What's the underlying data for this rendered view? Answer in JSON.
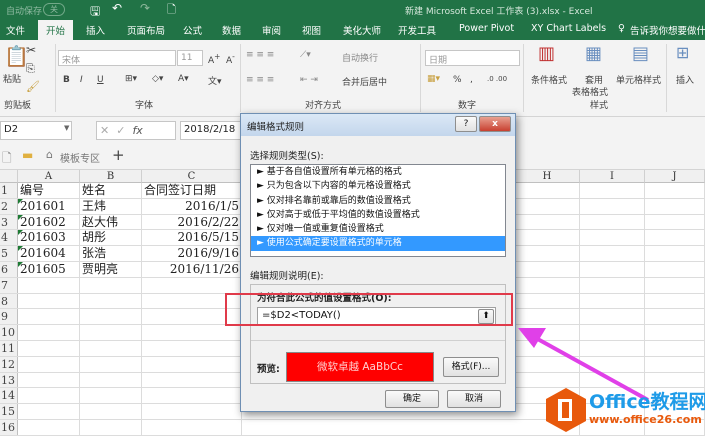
{
  "titlebar": {
    "autosave": "自动保存",
    "autosave_state": "关",
    "title": "新建 Microsoft Excel 工作表 (3).xlsx  -  Excel"
  },
  "tabs": [
    "文件",
    "开始",
    "插入",
    "页面布局",
    "公式",
    "数据",
    "审阅",
    "视图",
    "美化大师",
    "开发工具",
    "Power Pivot",
    "XY Chart Labels"
  ],
  "tell_me": "告诉我你想要做什么",
  "ribbon": {
    "paste": "粘贴",
    "clipboard": "剪贴板",
    "font_name": "宋体",
    "font_size": "11",
    "font_group": "字体",
    "bold": "B",
    "italic": "I",
    "underline": "U",
    "wrap_text": "自动换行",
    "merge_center": "合并后居中",
    "alignment_group": "对齐方式",
    "number_format": "日期",
    "percent": "%",
    "comma": ",",
    "number_group": "数字",
    "cond_format": "条件格式",
    "table_format_1": "套用",
    "table_format_2": "表格格式",
    "cell_style": "单元格样式",
    "styles_group": "样式",
    "insert": "插入"
  },
  "formula_bar": {
    "name_box": "D2",
    "value": "2018/2/18"
  },
  "sheet_tabs": {
    "template": "模板专区",
    "add": "+"
  },
  "columns": [
    "A",
    "B",
    "C",
    "H",
    "I",
    "J"
  ],
  "rows": [
    [
      "编号",
      "姓名",
      "合同签订日期"
    ],
    [
      "201601",
      "王炜",
      "2016/1/5"
    ],
    [
      "201602",
      "赵大伟",
      "2016/2/22"
    ],
    [
      "201603",
      "胡彤",
      "2016/5/15"
    ],
    [
      "201604",
      "张浩",
      "2016/9/16"
    ],
    [
      "201605",
      "贾明亮",
      "2016/11/26"
    ]
  ],
  "row_numbers": [
    "1",
    "2",
    "3",
    "4",
    "5",
    "6",
    "7",
    "8",
    "9",
    "10",
    "11",
    "12",
    "13",
    "14",
    "15",
    "16"
  ],
  "dialog": {
    "title": "编辑格式规则",
    "help": "?",
    "close": "x",
    "select_type_label": "选择规则类型(S):",
    "rule_types": [
      "► 基于各自值设置所有单元格的格式",
      "► 只为包含以下内容的单元格设置格式",
      "► 仅对排名靠前或靠后的数值设置格式",
      "► 仅对高于或低于平均值的数值设置格式",
      "► 仅对唯一值或重复值设置格式",
      "► 使用公式确定要设置格式的单元格"
    ],
    "selected_index": 5,
    "edit_desc_label": "编辑规则说明(E):",
    "formula_label": "为符合此公式的值设置格式(O):",
    "formula": "=$D2<TODAY()",
    "preview_label": "预览:",
    "preview_text": "微软卓越  AaBbCc",
    "format_button": "格式(F)...",
    "ok": "确定",
    "cancel": "取消"
  },
  "watermark": {
    "brand": "Office教程网",
    "url": "www.office26.com"
  },
  "colors": {
    "excel_green": "#217346",
    "highlight": "#e03a4a",
    "arrow": "#e040e8",
    "preview_fill": "#ff0000",
    "selection": "#3399ff"
  }
}
